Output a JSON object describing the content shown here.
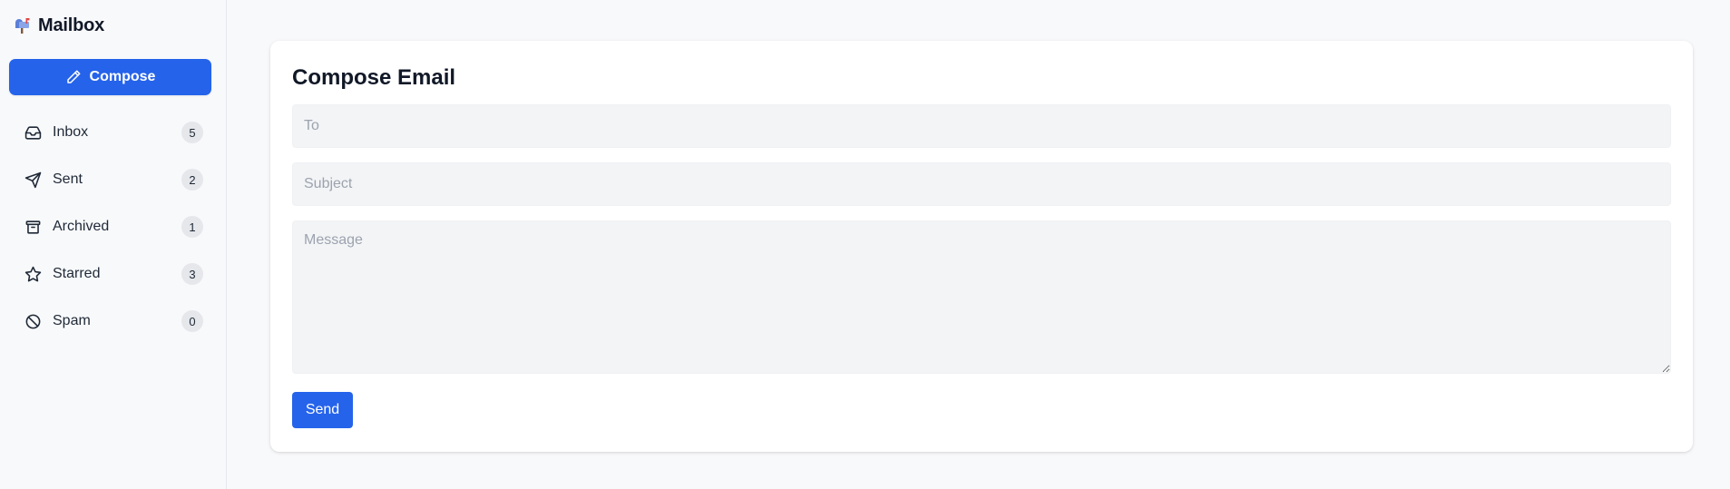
{
  "brand": {
    "title": "Mailbox",
    "icon": "mailbox-icon"
  },
  "sidebar": {
    "compose_label": "Compose",
    "compose_icon": "pencil-icon",
    "items": [
      {
        "label": "Inbox",
        "count": "5",
        "icon": "inbox-icon"
      },
      {
        "label": "Sent",
        "count": "2",
        "icon": "send-icon"
      },
      {
        "label": "Archived",
        "count": "1",
        "icon": "archive-icon"
      },
      {
        "label": "Starred",
        "count": "3",
        "icon": "star-icon"
      },
      {
        "label": "Spam",
        "count": "0",
        "icon": "ban-icon"
      }
    ]
  },
  "compose": {
    "title": "Compose Email",
    "to_placeholder": "To",
    "to_value": "",
    "subject_placeholder": "Subject",
    "subject_value": "",
    "message_placeholder": "Message",
    "message_value": "",
    "send_label": "Send"
  },
  "colors": {
    "accent": "#2563eb",
    "background": "#f8f9fb",
    "field_bg": "#f3f4f6",
    "badge_bg": "#e5e7eb"
  }
}
